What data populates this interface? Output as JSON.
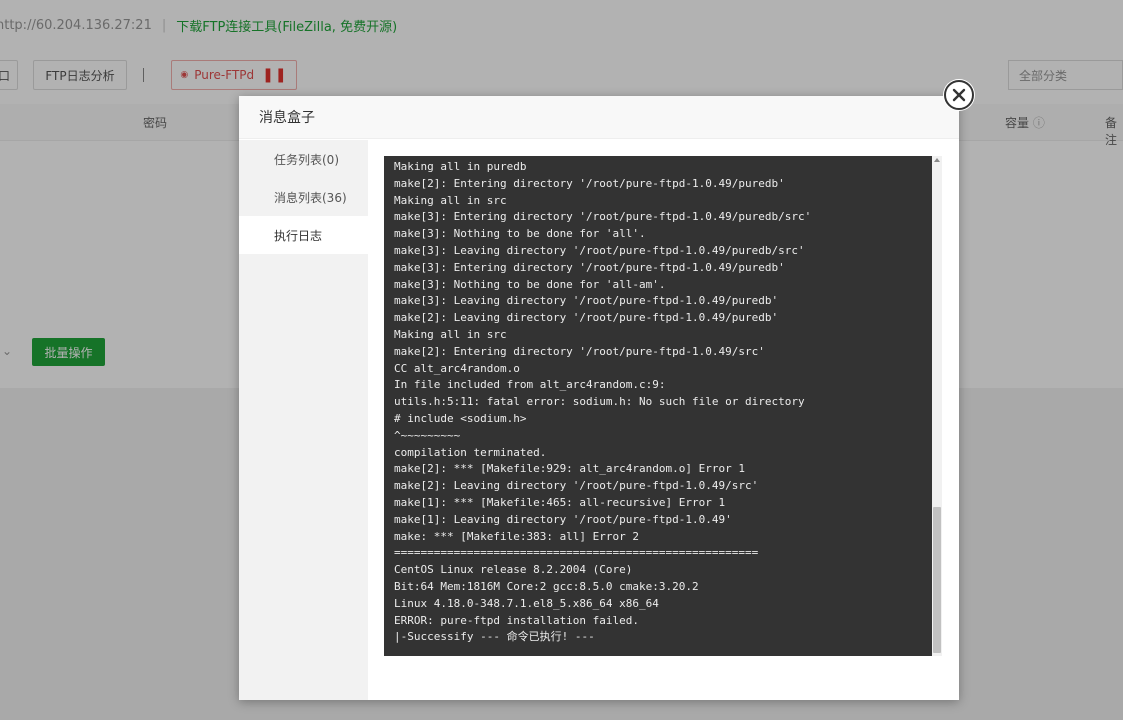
{
  "background": {
    "url": "http://60.204.136.27:21",
    "ftp_tool_link": "下载FTP连接工具(FileZilla, 免费开源)",
    "toolbar": {
      "partial_button": "口",
      "log_button": "FTP日志分析",
      "pure_ftpd_button": "Pure-FTPd",
      "category_select": "全部分类"
    },
    "table_headers": {
      "password": "密码",
      "capacity": "容量",
      "note": "备注"
    },
    "batch_button": "批量操作"
  },
  "modal": {
    "title": "消息盒子",
    "tabs": [
      {
        "label": "任务列表(0)"
      },
      {
        "label": "消息列表(36)"
      },
      {
        "label": "执行日志"
      }
    ],
    "active_tab": "执行日志",
    "log_lines": [
      "Making all in puredb",
      "make[2]: Entering directory '/root/pure-ftpd-1.0.49/puredb'",
      "Making all in src",
      "make[3]: Entering directory '/root/pure-ftpd-1.0.49/puredb/src'",
      "make[3]: Nothing to be done for 'all'.",
      "make[3]: Leaving directory '/root/pure-ftpd-1.0.49/puredb/src'",
      "make[3]: Entering directory '/root/pure-ftpd-1.0.49/puredb'",
      "make[3]: Nothing to be done for 'all-am'.",
      "make[3]: Leaving directory '/root/pure-ftpd-1.0.49/puredb'",
      "make[2]: Leaving directory '/root/pure-ftpd-1.0.49/puredb'",
      "Making all in src",
      "make[2]: Entering directory '/root/pure-ftpd-1.0.49/src'",
      "CC alt_arc4random.o",
      "In file included from alt_arc4random.c:9:",
      "utils.h:5:11: fatal error: sodium.h: No such file or directory",
      "# include <sodium.h>",
      "^~~~~~~~~~",
      "compilation terminated.",
      "make[2]: *** [Makefile:929: alt_arc4random.o] Error 1",
      "make[2]: Leaving directory '/root/pure-ftpd-1.0.49/src'",
      "make[1]: *** [Makefile:465: all-recursive] Error 1",
      "make[1]: Leaving directory '/root/pure-ftpd-1.0.49'",
      "make: *** [Makefile:383: all] Error 2",
      "=======================================================",
      "CentOS Linux release 8.2.2004 (Core)",
      "Bit:64 Mem:1816M Core:2 gcc:8.5.0 cmake:3.20.2",
      "Linux 4.18.0-348.7.1.el8_5.x86_64 x86_64",
      "ERROR: pure-ftpd installation failed.",
      "|-Successify --- 命令已执行! ---"
    ]
  },
  "colors": {
    "accent_green": "#20a53a",
    "terminal_bg": "#333333",
    "danger_red": "#e15050"
  },
  "icons": {
    "close": "close-circle-icon",
    "pause": "pause-icon",
    "capacity_hint": "question-circle-icon"
  }
}
